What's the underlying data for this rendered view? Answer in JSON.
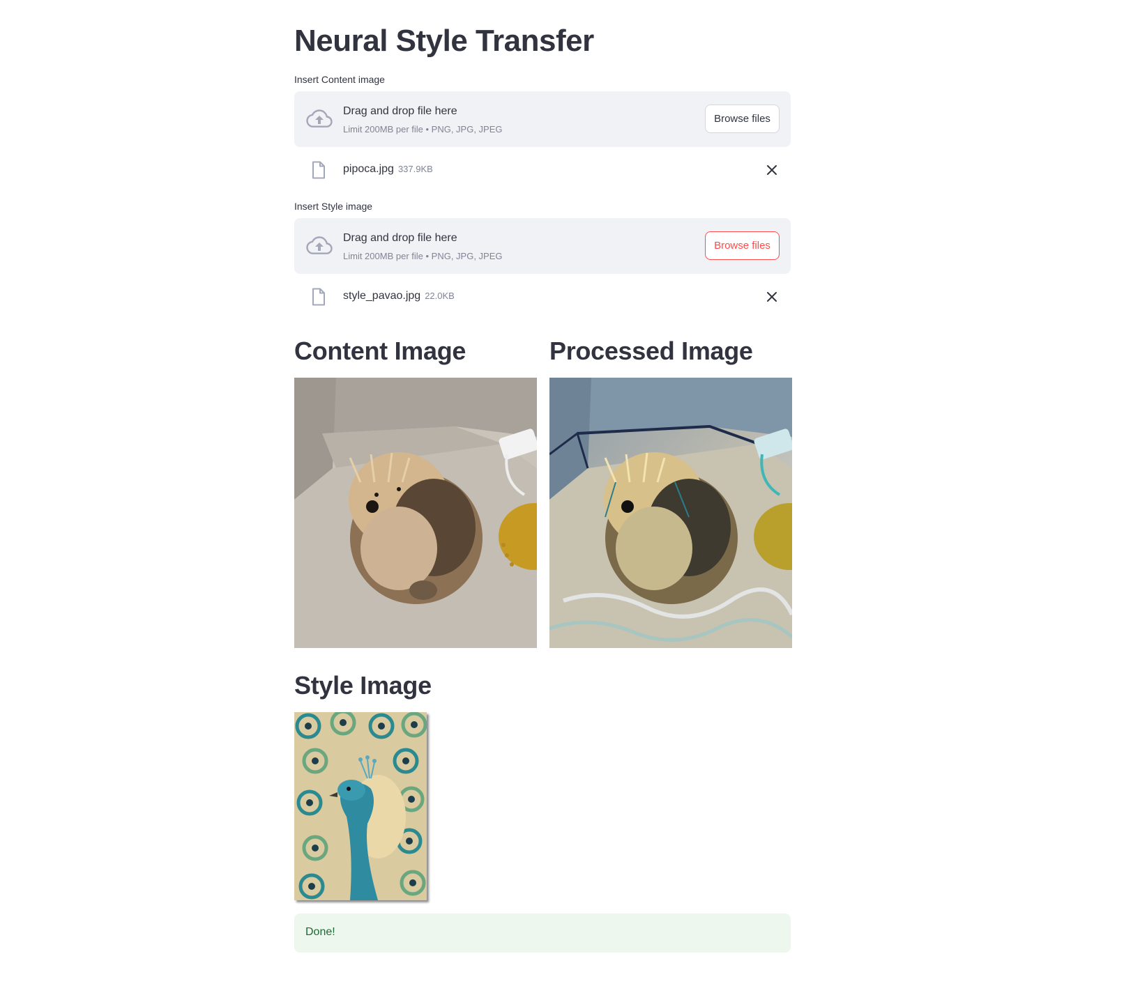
{
  "page": {
    "title": "Neural Style Transfer"
  },
  "content_uploader": {
    "label": "Insert Content image",
    "drop_title": "Drag and drop file here",
    "drop_sub": "Limit 200MB per file • PNG, JPG, JPEG",
    "browse_label": "Browse files",
    "file_name": "pipoca.jpg",
    "file_size": "337.9KB"
  },
  "style_uploader": {
    "label": "Insert Style image",
    "drop_title": "Drag and drop file here",
    "drop_sub": "Limit 200MB per file • PNG, JPG, JPEG",
    "browse_label": "Browse files",
    "file_name": "style_pavao.jpg",
    "file_size": "22.0KB"
  },
  "results": {
    "content_heading": "Content Image",
    "processed_heading": "Processed Image",
    "style_heading": "Style Image"
  },
  "status": {
    "message": "Done!"
  },
  "colors": {
    "accent": "#ff4b4b",
    "dropzone_bg": "#f0f2f6",
    "success_bg": "#eef7ee",
    "success_text": "#1b6a34"
  }
}
